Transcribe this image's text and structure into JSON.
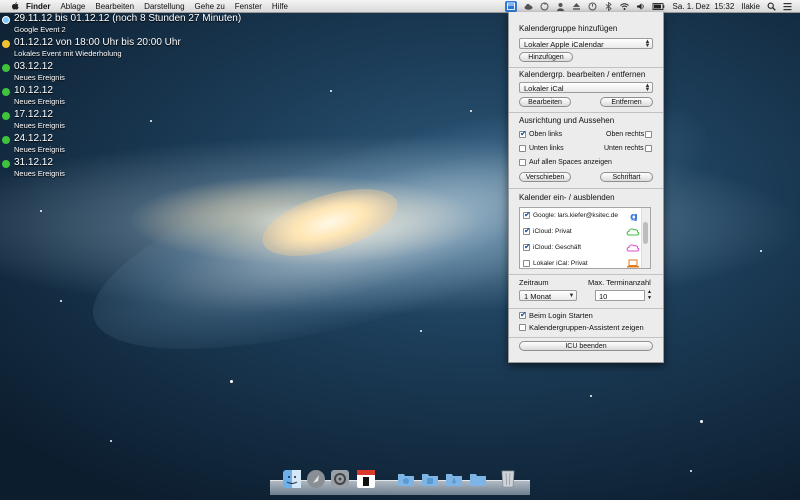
{
  "menubar": {
    "app_name": "Finder",
    "menus": [
      "Ablage",
      "Bearbeiten",
      "Darstellung",
      "Gehe zu",
      "Fenster",
      "Hilfe"
    ],
    "clock": "Sa. 1. Dez  15:32",
    "user": "Ilakie"
  },
  "events": [
    {
      "when": "29.11.12 bis 01.12.12 (noch 8 Stunden 27 Minuten)",
      "what": "Google Event 2",
      "color": "#7fc7ff"
    },
    {
      "when": "01.12.12 von 18:00 Uhr bis 20:00 Uhr",
      "what": "Lokales Event mit Wiederholung",
      "color": "#f2c230"
    },
    {
      "when": "03.12.12",
      "what": "Neues Ereignis",
      "color": "#3fc23c"
    },
    {
      "when": "10.12.12",
      "what": "Neues Ereignis",
      "color": "#3fc23c"
    },
    {
      "when": "17.12.12",
      "what": "Neues Ereignis",
      "color": "#3fc23c"
    },
    {
      "when": "24.12.12",
      "what": "Neues Ereignis",
      "color": "#3fc23c"
    },
    {
      "when": "31.12.12",
      "what": "Neues Ereignis",
      "color": "#3fc23c"
    }
  ],
  "panel": {
    "add_group": {
      "title": "Kalendergruppe hinzufügen",
      "select_value": "Lokaler Apple iCalendar",
      "add_button": "Hinzufügen"
    },
    "edit_group": {
      "title": "Kalendergrp. bearbeiten / entfernen",
      "select_value": "Lokaler iCal",
      "edit_button": "Bearbeiten",
      "remove_button": "Entfernen"
    },
    "alignment": {
      "title": "Ausrichtung und Aussehen",
      "top_left": "Oben links",
      "top_right": "Oben rechts",
      "bottom_left": "Unten links",
      "bottom_right": "Unten rechts",
      "all_spaces": "Auf allen Spaces anzeigen",
      "move_button": "Verschieben",
      "font_button": "Schriftart"
    },
    "calendars": {
      "title": "Kalender ein- / ausblenden",
      "items": [
        {
          "label": "Google: lars.kiefer@ksitec.de",
          "checked": true
        },
        {
          "label": "iCloud: Privat",
          "checked": true
        },
        {
          "label": "iCloud: Geschäft",
          "checked": true
        },
        {
          "label": "Lokaler iCal: Privat",
          "checked": false
        }
      ]
    },
    "range": {
      "period_label": "Zeitraum",
      "period_value": "1 Monat",
      "max_label": "Max. Terminanzahl",
      "max_value": "10"
    },
    "login_start": "Beim Login Starten",
    "assistant": "Kalendergruppen-Assistent zeigen",
    "quit_button": "ICU beenden"
  }
}
